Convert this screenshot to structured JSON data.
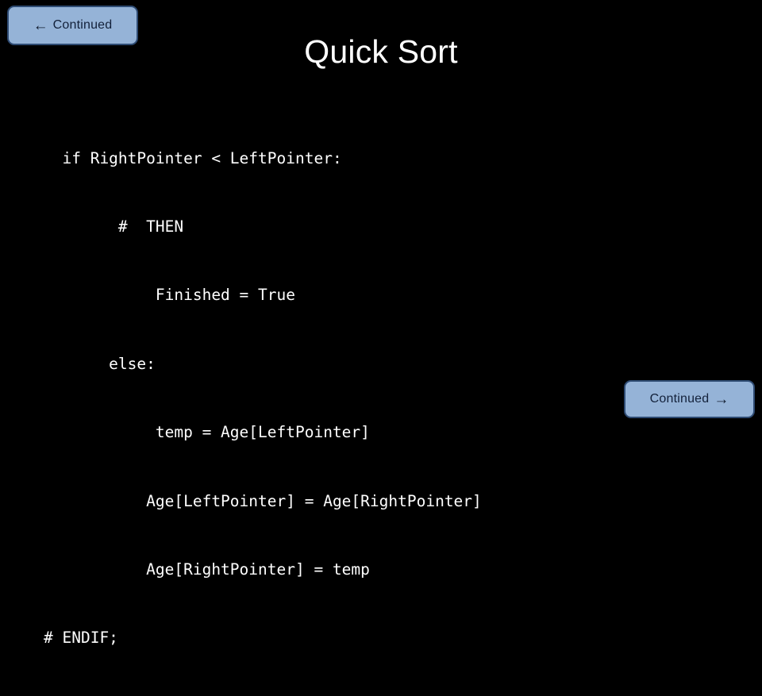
{
  "slide": {
    "background_color": "#000000",
    "text_color": "#ffffff",
    "title": "Quick Sort"
  },
  "nav": {
    "back": {
      "label": "Continued",
      "arrow": "←",
      "arrow_icon_name": "arrow-left-icon",
      "fill_color": "#95b3d7",
      "border_color": "#2e4b73",
      "text_color": "#13213a"
    },
    "forward": {
      "label": "Continued",
      "arrow": "→",
      "arrow_icon_name": "arrow-right-icon",
      "fill_color": "#95b3d7",
      "border_color": "#2e4b73",
      "text_color": "#13213a"
    }
  },
  "code": {
    "language_style": "pseudocode",
    "lines": [
      "  if RightPointer < LeftPointer:",
      "        #  THEN",
      "            Finished = True",
      "       else:",
      "            temp = Age[LeftPointer]",
      "           Age[LeftPointer] = Age[RightPointer]",
      "           Age[RightPointer] = temp",
      "# ENDIF;"
    ]
  }
}
